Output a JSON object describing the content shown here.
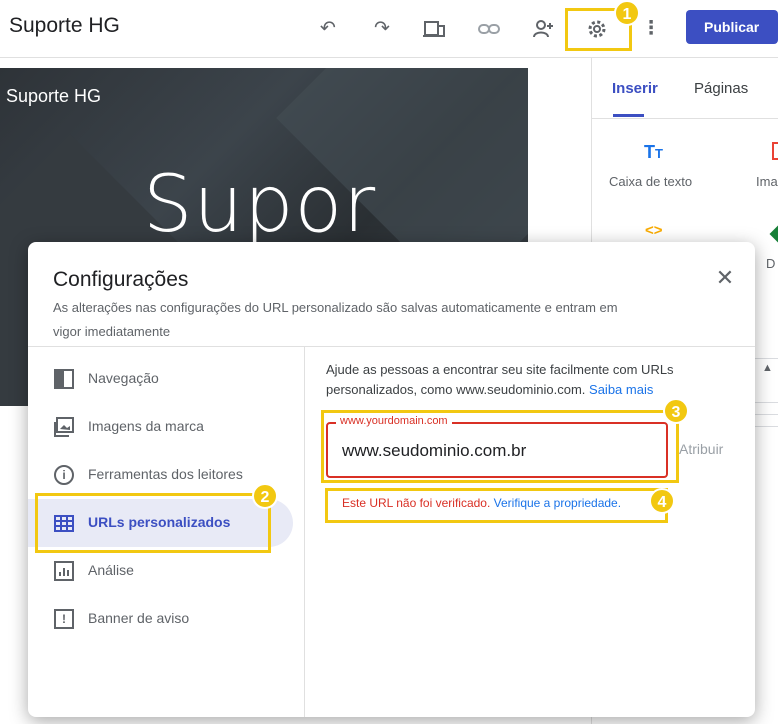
{
  "topbar": {
    "site_title": "Suporte HG",
    "publish_label": "Publicar",
    "icons": [
      "undo-icon",
      "redo-icon",
      "preview-devices-icon",
      "link-icon",
      "add-person-icon",
      "gear-icon",
      "more-vert-icon"
    ]
  },
  "canvas": {
    "header_small": "Suporte HG",
    "header_big": "Supor"
  },
  "right_panel": {
    "tabs": [
      "Inserir",
      "Páginas"
    ],
    "active_tab": "Inserir",
    "items": [
      {
        "icon": "text-box-icon",
        "label": "Caixa de texto"
      },
      {
        "icon": "image-icon",
        "label": "Ima"
      },
      {
        "icon": "embed-icon",
        "label": ""
      },
      {
        "icon": "drive-icon",
        "label": "D"
      }
    ]
  },
  "modal": {
    "title": "Configurações",
    "subtitle_line1": "As alterações nas configurações do URL personalizado são salvas automaticamente e entram em",
    "subtitle_line2": "vigor imediatamente",
    "nav": [
      {
        "label": "Navegação",
        "icon": "navigation-icon"
      },
      {
        "label": "Imagens da marca",
        "icon": "brand-images-icon"
      },
      {
        "label": "Ferramentas dos leitores",
        "icon": "info-icon"
      },
      {
        "label": "URLs personalizados",
        "icon": "url-grid-icon",
        "active": true
      },
      {
        "label": "Análise",
        "icon": "analytics-icon"
      },
      {
        "label": "Banner de aviso",
        "icon": "banner-icon"
      }
    ],
    "help_line1": "Ajude as pessoas a encontrar seu site facilmente com URLs",
    "help_line2": "personalizados, como www.seudominio.com.",
    "help_link": "Saiba mais",
    "field_label": "www.yourdomain.com",
    "field_value": "www.seudominio.com.br",
    "assign_label": "Atribuir",
    "error_text": "Este URL não foi verificado.",
    "error_link": "Verifique a propriedade."
  },
  "annotations": {
    "badges": [
      "1",
      "2",
      "3",
      "4"
    ],
    "highlight_color": "#f2c811"
  },
  "colors": {
    "accent": "#3c4fc2",
    "error": "#d93025",
    "link": "#1a73e8"
  }
}
